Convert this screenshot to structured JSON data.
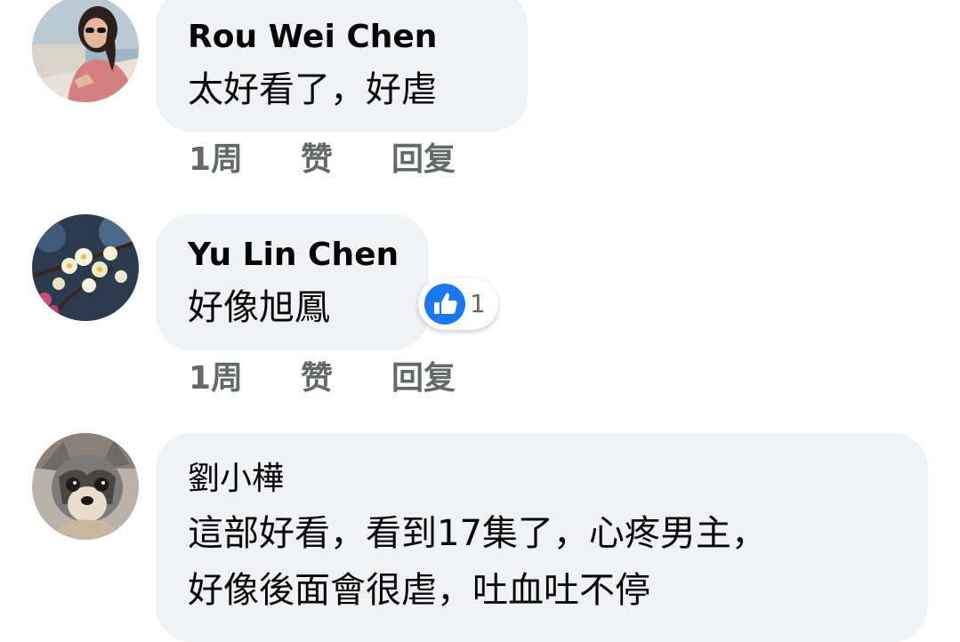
{
  "comments": [
    {
      "author": "Rou Wei Chen",
      "lines": [
        "太好看了，好虐"
      ],
      "time": "1周",
      "like_label": "赞",
      "reply_label": "回复",
      "avatar_icon": "woman-sunglasses-photo-icon"
    },
    {
      "author": "Yu Lin Chen",
      "lines": [
        "好像旭鳳"
      ],
      "time": "1周",
      "like_label": "赞",
      "reply_label": "回复",
      "reaction_icon": "like-thumbs-up-icon",
      "reaction_count": "1",
      "avatar_icon": "plum-blossom-photo-icon"
    },
    {
      "author": "劉小樺",
      "lines": [
        "這部好看，看到17集了，心疼男主，",
        "好像後面會很虐，吐血吐不停"
      ],
      "avatar_icon": "dog-photo-icon"
    }
  ],
  "colors": {
    "bubble": "#f0f2f5",
    "text": "#050505",
    "meta": "#65676b",
    "like_blue": "#1877f2"
  }
}
